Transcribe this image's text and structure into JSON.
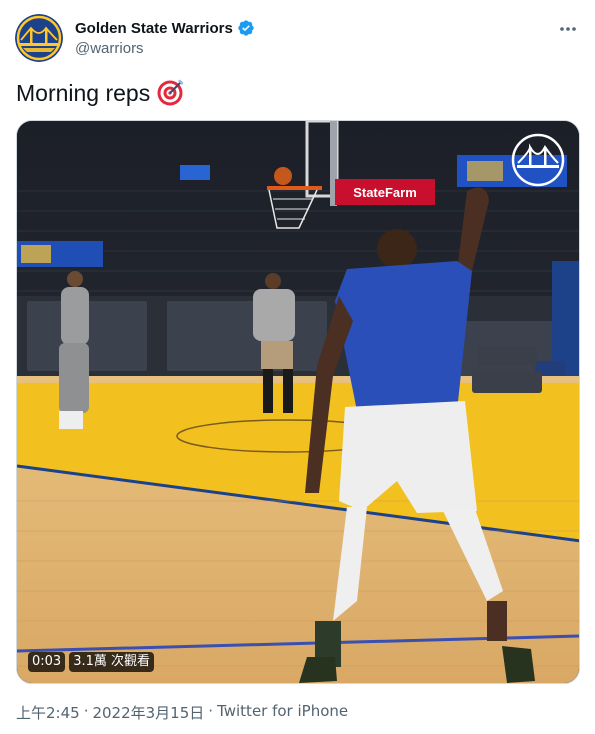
{
  "author": {
    "display_name": "Golden State Warriors",
    "handle": "@warriors",
    "verified": true,
    "avatar_icon": "warriors-bridge-logo-icon",
    "brand_colors": {
      "blue": "#1d428a",
      "gold": "#ffc72c"
    }
  },
  "tweet": {
    "text": "Morning reps",
    "emoji_icon": "direct-hit-target-icon"
  },
  "media": {
    "type": "video",
    "duration": "0:03",
    "views": "3.1萬 次觀看",
    "signage": {
      "sponsor_text": "StateFarm"
    }
  },
  "footer": {
    "time": "上午2:45",
    "date": "2022年3月15日",
    "source": "Twitter for iPhone"
  },
  "colors": {
    "text_primary": "#0f1419",
    "text_secondary": "#536471",
    "verified_blue": "#1d9bf0"
  }
}
